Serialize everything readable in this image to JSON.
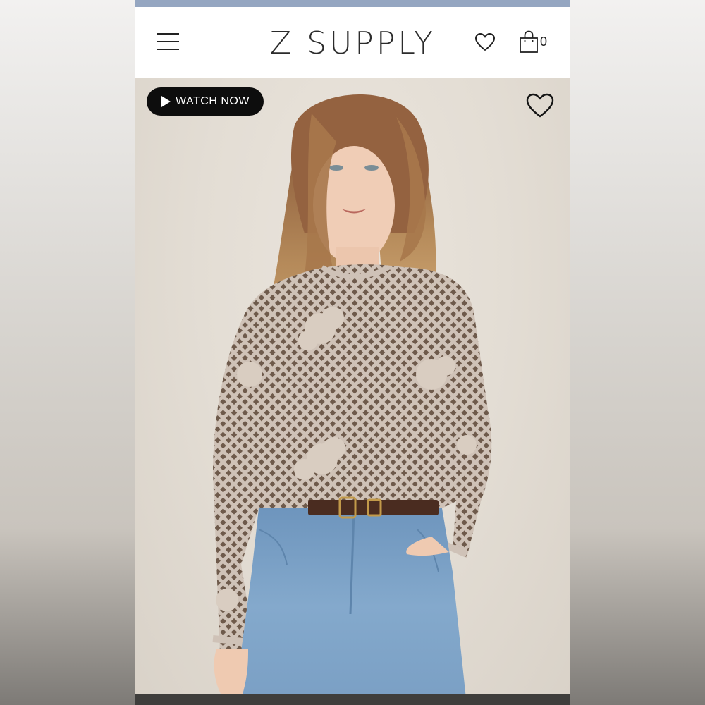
{
  "header": {
    "logo_text": "Z SUPPLY",
    "cart_count": "0"
  },
  "hero": {
    "watch_button_label": "WATCH NOW"
  },
  "icons": {
    "menu": "hamburger-icon",
    "wishlist": "heart-icon",
    "cart": "shopping-bag-icon",
    "play": "play-icon",
    "favorite": "heart-outline-icon"
  },
  "colors": {
    "top_bar": "#95a6c1",
    "watch_button_bg": "#0d0d0d",
    "hero_bg": "#e3ddd4"
  }
}
